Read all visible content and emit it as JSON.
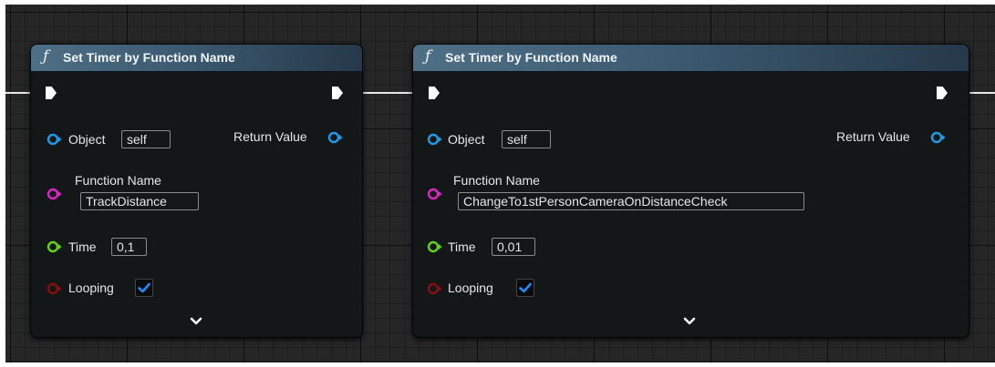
{
  "nodes": [
    {
      "title": "Set Timer by Function Name",
      "fx_glyph": "ƒ",
      "object": {
        "label": "Object",
        "value": "self"
      },
      "return_value": {
        "label": "Return Value"
      },
      "function_name": {
        "label": "Function Name",
        "value": "TrackDistance"
      },
      "time": {
        "label": "Time",
        "value": "0,1"
      },
      "looping": {
        "label": "Looping",
        "checked": true
      }
    },
    {
      "title": "Set Timer by Function Name",
      "fx_glyph": "ƒ",
      "object": {
        "label": "Object",
        "value": "self"
      },
      "return_value": {
        "label": "Return Value"
      },
      "function_name": {
        "label": "Function Name",
        "value": "ChangeTo1stPersonCameraOnDistanceCheck"
      },
      "time": {
        "label": "Time",
        "value": "0,01"
      },
      "looping": {
        "label": "Looping",
        "checked": true
      }
    }
  ],
  "colors": {
    "object_pin": "#1e9be8",
    "function_name_pin": "#e024c8",
    "time_pin": "#61d413",
    "looping_pin": "#8b0d0d",
    "checkbox_mark": "#1a8cff",
    "exec_wire": "#e8e8e8"
  },
  "icons": {
    "exec_pin": "exec-arrow-icon",
    "data_pin": "ring-pin-icon",
    "expand": "chevron-down-icon",
    "checkmark": "checkmark-icon"
  }
}
